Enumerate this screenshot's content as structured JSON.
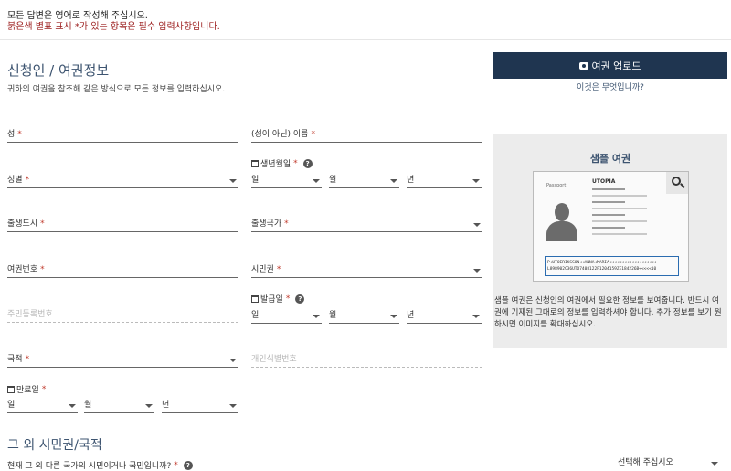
{
  "notice": {
    "line1": "모든 답변은 영어로 작성해 주십시오.",
    "line2": "붉은색 별표 표시 *가 있는 항목은 필수 입력사항입니다."
  },
  "section": {
    "title": "신청인 / 여권정보",
    "subtitle": "귀하의 여권을 참조해 같은 방식으로 모든 정보를 입력하십시오."
  },
  "fields": {
    "surname": "성",
    "given_name": "(성이 아닌) 이름",
    "gender": "성별",
    "birth_date": "생년월일",
    "birth_city": "출생도시",
    "birth_country": "출생국가",
    "passport_number": "여권번호",
    "citizenship": "시민권",
    "national_id": "주민등록번호",
    "issue_date": "발급일",
    "nationality": "국적",
    "personal_id": "개인식별번호",
    "expiry_date": "만료일"
  },
  "required_mark": "*",
  "date_parts": {
    "day": "일",
    "month": "월",
    "year": "년"
  },
  "upload": {
    "button": "여권 업로드",
    "whatis": "이것은 무엇입니까?"
  },
  "sample": {
    "title": "샘플 여권",
    "country": "UTOPIA",
    "passport_label": "Passport",
    "mrz1": "P<UTOERIKSSON<<ANNA<MARIA<<<<<<<<<<<<<<<<<<<",
    "mrz2": "L898902C36UTO7408122F1204159ZE184226B<<<<<10",
    "description": "샘플 여권은 신청인의 여권에서 필요한 정보를 보여줍니다. 반드시 여권에 기재된 그대로의 정보를 입력하셔야 합니다. 추가 정보를 보기 원하시면 이미지를 확대하십시오."
  },
  "section2": {
    "title": "그 외 시민권/국적",
    "question": "현재 그 외 다른 국가의 시민이거나 국민입니까?",
    "select_placeholder": "선택해 주십시오"
  },
  "colors": {
    "primary": "#1f3550",
    "heading": "#3d5470",
    "required": "#c0392b",
    "panel": "#ececec"
  }
}
